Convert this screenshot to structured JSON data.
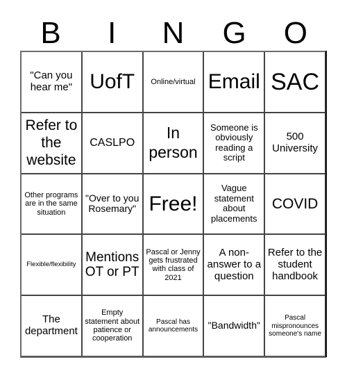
{
  "header": {
    "letters": [
      "B",
      "I",
      "N",
      "G",
      "O"
    ]
  },
  "board": {
    "rows": [
      [
        "\"Can you hear me\"",
        "UofT",
        "Online/virtual",
        "Email",
        "SAC"
      ],
      [
        "Refer to the website",
        "CASLPO",
        "In person",
        "Someone is obviously reading a script",
        "500 University"
      ],
      [
        "Other programs are in the same situation",
        "\"Over to you Rosemary\"",
        "Free!",
        "Vague statement about placements",
        "COVID"
      ],
      [
        "Flexible/flexibility",
        "Mentions OT or PT",
        "Pascal or Jenny gets frustrated with class of 2021",
        "A non-answer to a question",
        "Refer to the student handbook"
      ],
      [
        "The department",
        "Empty statement about patience or cooperation",
        "Pascal has announcements",
        "\"Bandwidth\"",
        "Pascal mispronounces someone's name"
      ]
    ],
    "free_space": {
      "row": 2,
      "col": 2,
      "label": "Free!"
    }
  }
}
